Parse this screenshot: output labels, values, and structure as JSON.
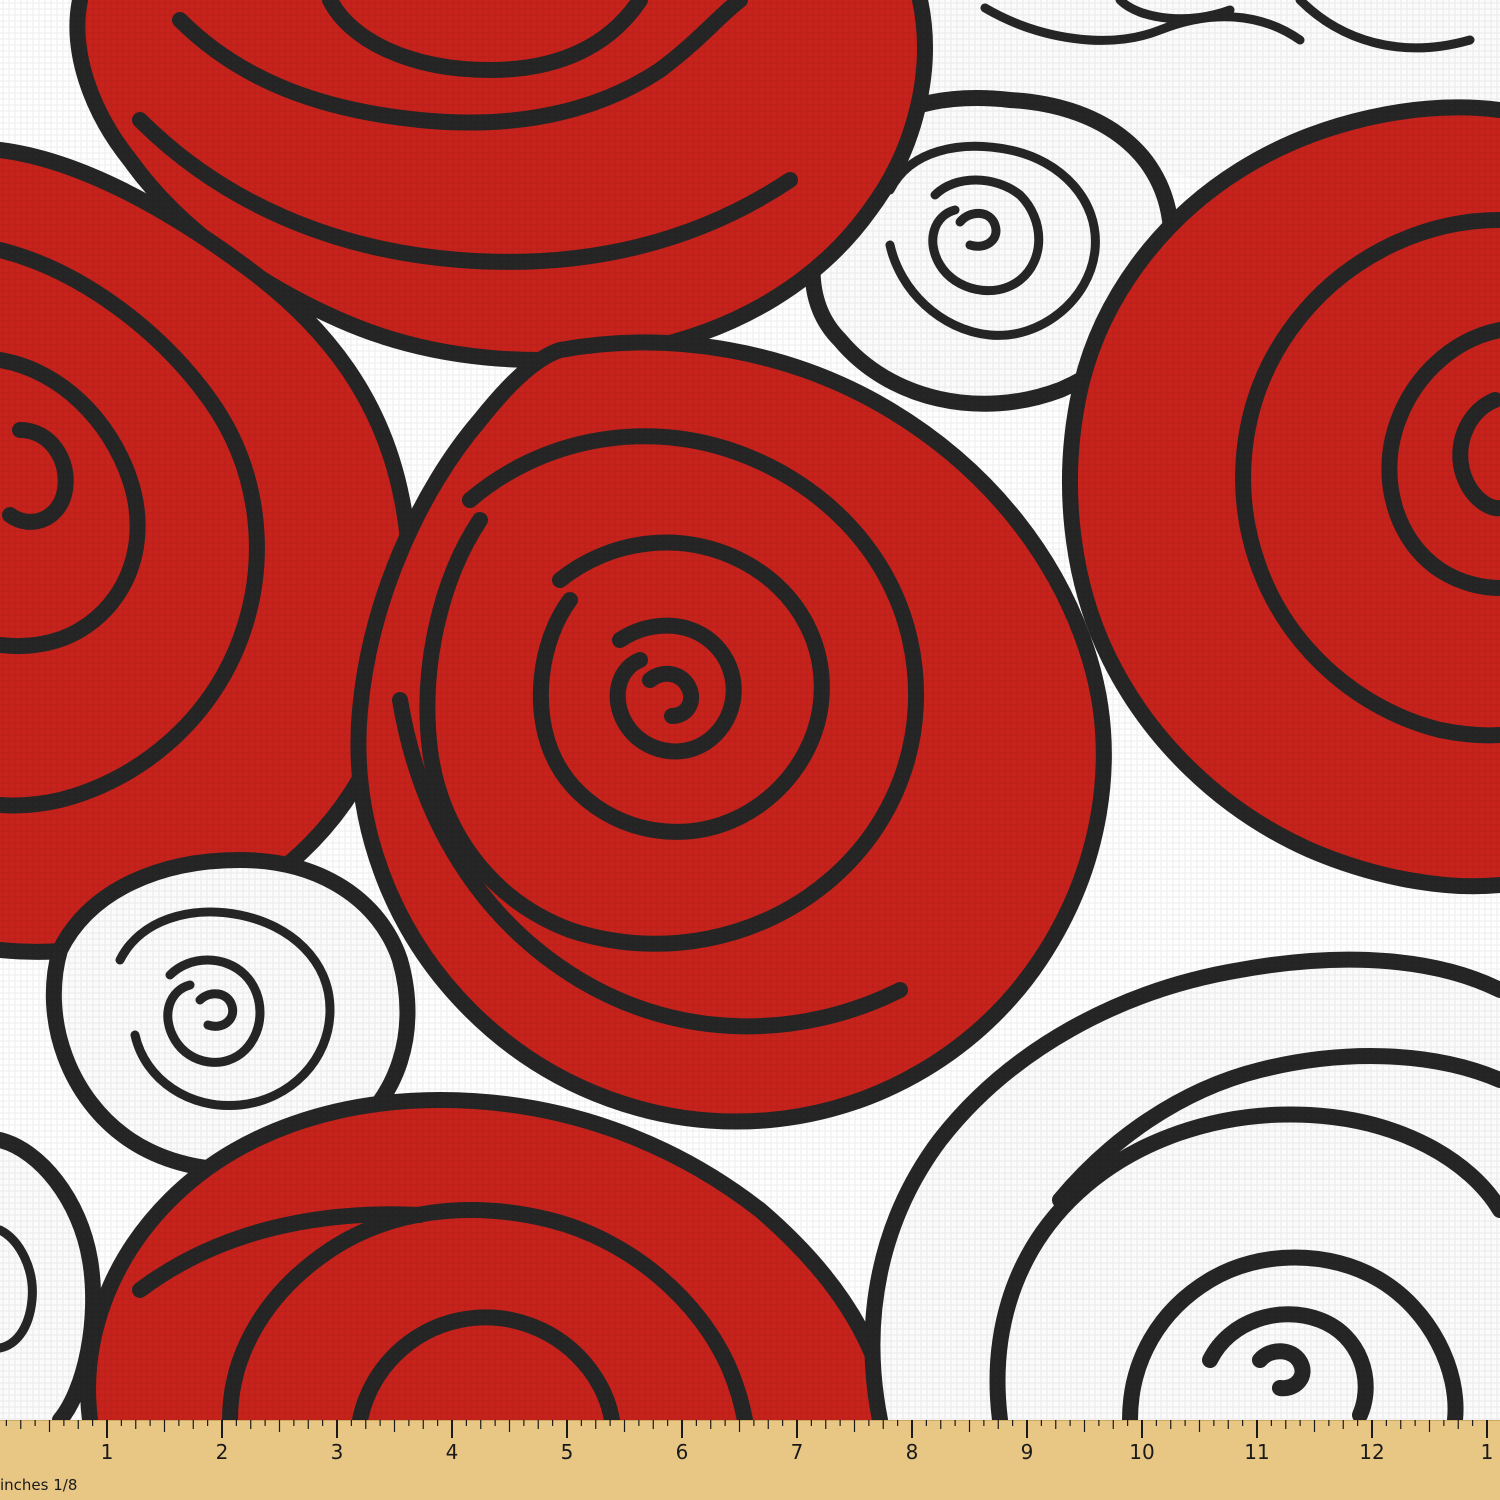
{
  "fabric": {
    "pattern_name": "rose-print",
    "colors": {
      "background": "#ffffff",
      "petal_red": "#c8221c",
      "petal_red_deep": "#b71b17",
      "outline": "#262626",
      "petal_white": "#fbfbfb"
    },
    "weave_texture": true
  },
  "ruler": {
    "unit_label": "inches 1/8",
    "numbers": [
      "1",
      "2",
      "3",
      "4",
      "5",
      "6",
      "7",
      "8",
      "9",
      "10",
      "11",
      "12",
      "1"
    ],
    "colors": {
      "wood": "#e8c785",
      "wood_edge": "#cfa95f",
      "ink": "#1a1a1a"
    }
  }
}
